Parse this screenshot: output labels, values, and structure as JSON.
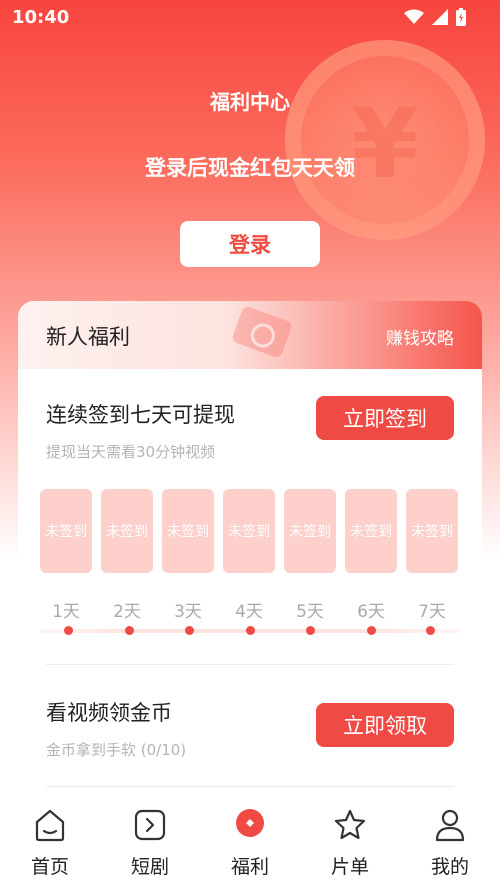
{
  "status_bar": {
    "time": "10:40"
  },
  "hero": {
    "title": "福利中心",
    "subtitle": "登录后现金红包天天领",
    "login_label": "登录",
    "coin_symbol": "¥"
  },
  "newbie": {
    "title": "新人福利",
    "guide_link": "赚钱攻略"
  },
  "checkin": {
    "title": "连续签到七天可提现",
    "desc": "提现当天需看30分钟视频",
    "button": "立即签到",
    "days": [
      {
        "status": "未签到",
        "label": "1天"
      },
      {
        "status": "未签到",
        "label": "2天"
      },
      {
        "status": "未签到",
        "label": "3天"
      },
      {
        "status": "未签到",
        "label": "4天"
      },
      {
        "status": "未签到",
        "label": "5天"
      },
      {
        "status": "未签到",
        "label": "6天"
      },
      {
        "status": "未签到",
        "label": "7天"
      }
    ]
  },
  "video_task": {
    "title": "看视频领金币",
    "desc": "金币拿到手软 (0/10)",
    "button": "立即领取"
  },
  "tabbar": {
    "items": [
      {
        "label": "首页",
        "icon": "home-icon"
      },
      {
        "label": "短剧",
        "icon": "play-icon"
      },
      {
        "label": "福利",
        "icon": "welfare-icon",
        "active": true
      },
      {
        "label": "片单",
        "icon": "star-icon"
      },
      {
        "label": "我的",
        "icon": "profile-icon"
      }
    ]
  },
  "colors": {
    "accent": "#ef4a44",
    "muted_text": "#b4b4b4",
    "day_box": "#fdd0cc"
  }
}
